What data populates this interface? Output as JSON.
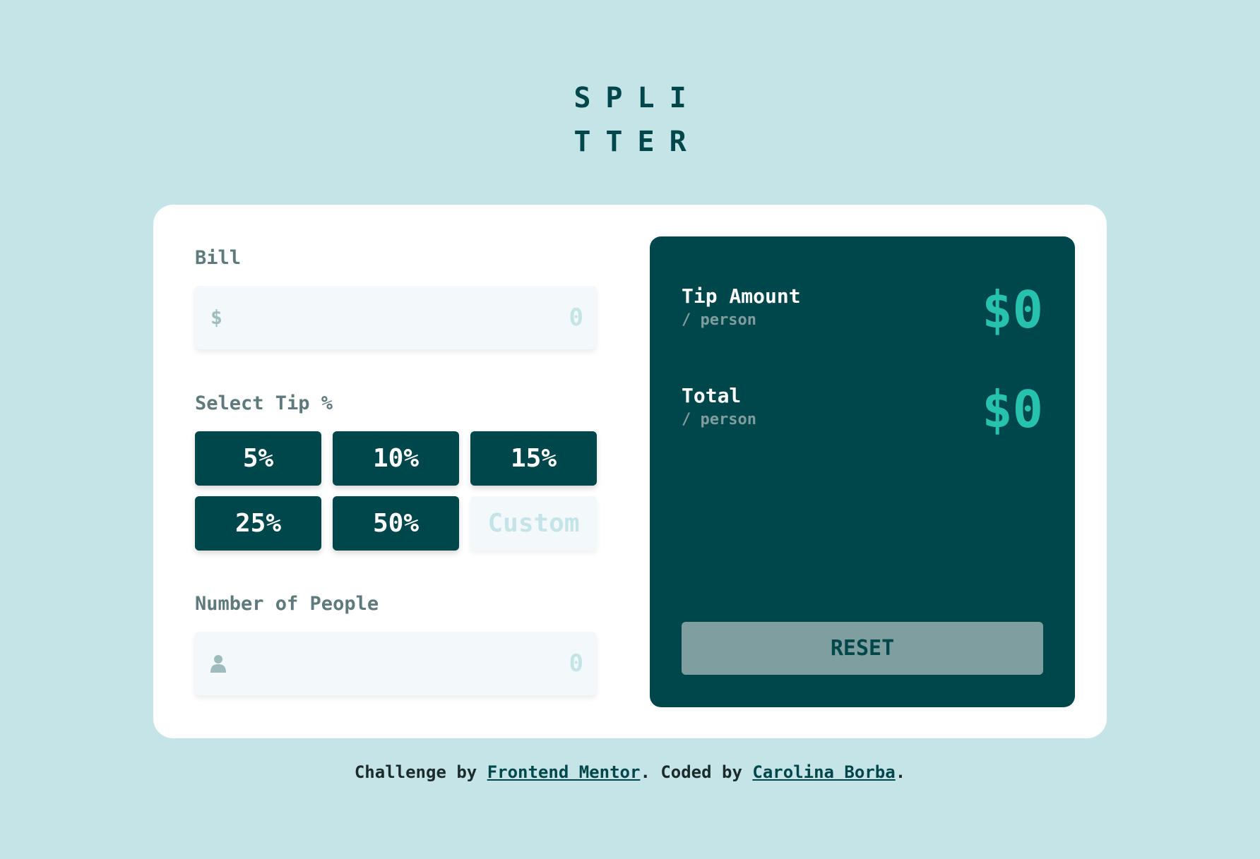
{
  "logo": {
    "line1": "SPLI",
    "line2": "TTER"
  },
  "bill": {
    "label": "Bill",
    "prefix": "$",
    "value": "0"
  },
  "tip": {
    "label": "Select Tip %",
    "options": [
      "5%",
      "10%",
      "15%",
      "25%",
      "50%"
    ],
    "custom_placeholder": "Custom"
  },
  "people": {
    "label": "Number of People",
    "value": "0"
  },
  "results": {
    "tip_amount": {
      "title": "Tip Amount",
      "sub": "/ person",
      "value": "$0"
    },
    "total": {
      "title": "Total",
      "sub": "/ person",
      "value": "$0"
    },
    "reset_label": "RESET"
  },
  "footer": {
    "prefix": "Challenge by ",
    "link1": "Frontend Mentor",
    "middle": ". Coded by ",
    "link2": "Carolina Borba",
    "suffix": "."
  },
  "colors": {
    "background": "#c5e4e7",
    "dark_cyan": "#00474b",
    "accent": "#26c2ae",
    "muted": "#5e7a7d"
  }
}
